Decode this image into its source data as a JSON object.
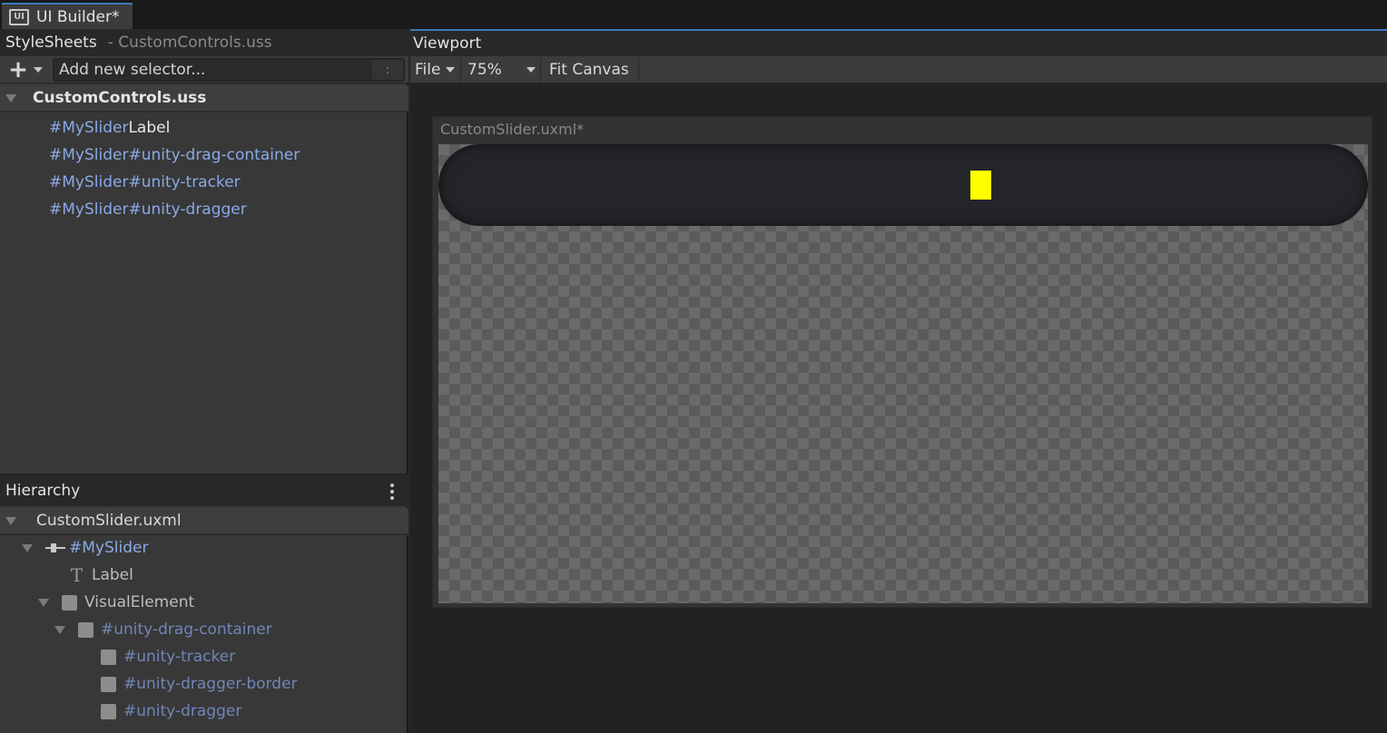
{
  "window": {
    "tab_title": "UI Builder*",
    "tab_icon": "UI"
  },
  "stylesheets": {
    "title": "StyleSheets",
    "subtitle": "- CustomControls.uss",
    "add_selector_placeholder": "Add new selector...",
    "colon": ":",
    "file": "CustomControls.uss",
    "selectors": [
      {
        "prefix": "#MySlider",
        "suffix": "Label"
      },
      {
        "prefix": "#MySlider",
        "suffix": "#unity-drag-container"
      },
      {
        "prefix": "#MySlider",
        "suffix": "#unity-tracker"
      },
      {
        "prefix": "#MySlider",
        "suffix": "#unity-dragger"
      }
    ]
  },
  "hierarchy": {
    "title": "Hierarchy",
    "file": "CustomSlider.uxml",
    "items": [
      {
        "label": "#MySlider"
      },
      {
        "label": "Label",
        "icon": "T"
      },
      {
        "label": "VisualElement"
      },
      {
        "label": "#unity-drag-container"
      },
      {
        "label": "#unity-tracker"
      },
      {
        "label": "#unity-dragger-border"
      },
      {
        "label": "#unity-dragger"
      }
    ]
  },
  "viewport": {
    "title": "Viewport",
    "file_menu": "File",
    "zoom": "75%",
    "fit_canvas": "Fit Canvas",
    "canvas_title": "CustomSlider.uxml*"
  },
  "colors": {
    "accent": "#3a79bb",
    "selector_blue": "#8aa9e6",
    "dragger": "#ffff00",
    "track": "#24252a"
  }
}
